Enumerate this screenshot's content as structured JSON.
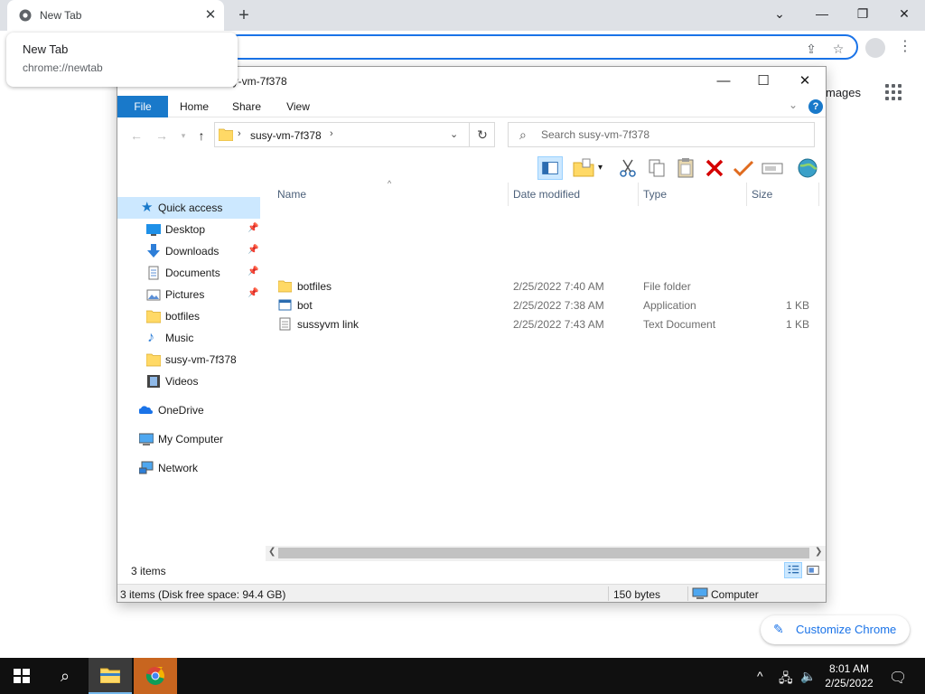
{
  "browser": {
    "tab_title": "New Tab",
    "tooltip_title": "New Tab",
    "tooltip_url": "chrome://newtab",
    "ntp_images_link": "mages",
    "customize_label": "Customize Chrome"
  },
  "explorer": {
    "title": "susy-vm-7f378",
    "ribbon_tabs": [
      "File",
      "Home",
      "Share",
      "View"
    ],
    "address_crumb": "susy-vm-7f378",
    "search_placeholder": "Search susy-vm-7f378",
    "nav": {
      "quick_access": "Quick access",
      "items": [
        "Desktop",
        "Downloads",
        "Documents",
        "Pictures",
        "botfiles",
        "Music",
        "susy-vm-7f378",
        "Videos"
      ],
      "onedrive": "OneDrive",
      "my_computer": "My Computer",
      "network": "Network"
    },
    "columns": [
      "Name",
      "Date modified",
      "Type",
      "Size"
    ],
    "files": [
      {
        "name": "botfiles",
        "date": "2/25/2022 7:40 AM",
        "type": "File folder",
        "size": "",
        "icon": "folder-icon"
      },
      {
        "name": "bot",
        "date": "2/25/2022 7:38 AM",
        "type": "Application",
        "size": "1 KB",
        "icon": "application-icon"
      },
      {
        "name": "sussyvm link",
        "date": "2/25/2022 7:43 AM",
        "type": "Text Document",
        "size": "1 KB",
        "icon": "text-document-icon"
      }
    ],
    "item_count": "3 items",
    "status": {
      "left": "3 items (Disk free space: 94.4 GB)",
      "bytes": "150 bytes",
      "location": "Computer"
    }
  },
  "taskbar": {
    "time": "8:01 AM",
    "date": "2/25/2022"
  },
  "colors": {
    "accent_blue": "#1979ca",
    "selection": "#cce8ff",
    "chrome_blue": "#1a73e8",
    "folder_yellow": "#ffd966"
  }
}
